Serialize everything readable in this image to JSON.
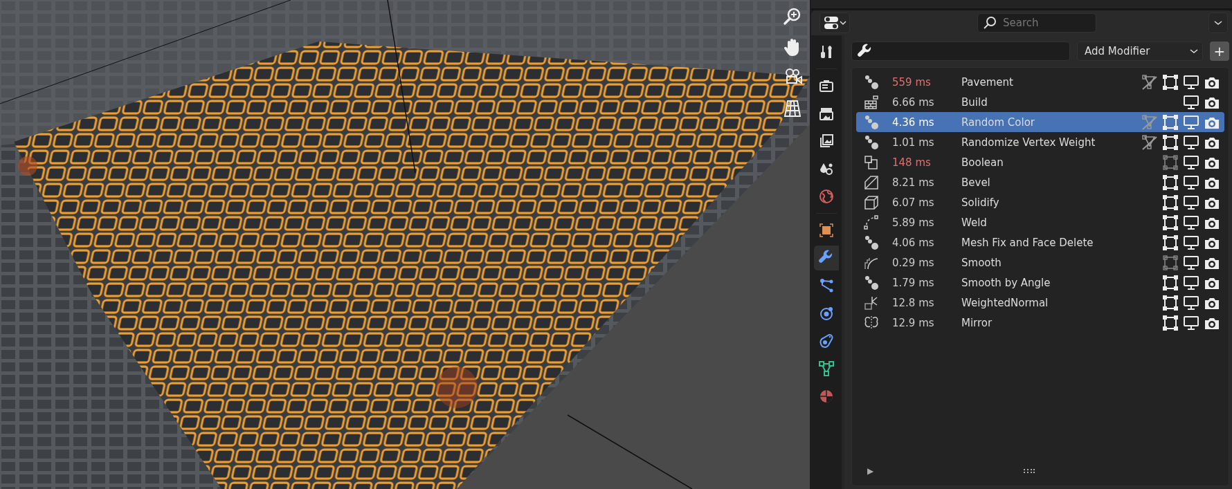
{
  "header": {
    "search": {
      "placeholder": "Search"
    }
  },
  "tabs": [
    {
      "kind": "tool",
      "selected": false
    },
    {
      "kind": "render",
      "selected": false
    },
    {
      "kind": "output",
      "selected": false
    },
    {
      "kind": "view_layer",
      "selected": false
    },
    {
      "kind": "scene",
      "selected": false
    },
    {
      "kind": "world",
      "selected": false
    },
    {
      "kind": "object",
      "selected": false
    },
    {
      "kind": "modifiers",
      "selected": true
    },
    {
      "kind": "particles",
      "selected": false
    },
    {
      "kind": "physics",
      "selected": false
    },
    {
      "kind": "constraints",
      "selected": false
    },
    {
      "kind": "data",
      "selected": false
    },
    {
      "kind": "material",
      "selected": false
    }
  ],
  "toolbar": {
    "add_modifier": "Add Modifier",
    "add_button": "+"
  },
  "modifiers": [
    {
      "kind": "nodes",
      "time": "559 ms",
      "slow": true,
      "name": "Pavement",
      "selected": false,
      "cage_toggle": true,
      "edit_toggle": true,
      "edit_mode": true,
      "viewport": true,
      "render": true
    },
    {
      "kind": "build",
      "time": "6.66 ms",
      "slow": false,
      "name": "Build",
      "selected": false,
      "cage_toggle": false,
      "edit_toggle": false,
      "viewport": true,
      "render": true
    },
    {
      "kind": "nodes",
      "time": "4.36 ms",
      "slow": false,
      "name": "Random Color",
      "selected": true,
      "cage_toggle": true,
      "edit_toggle": true,
      "edit_mode": true,
      "viewport": true,
      "render": true
    },
    {
      "kind": "nodes",
      "time": "1.01 ms",
      "slow": false,
      "name": "Randomize Vertex Weight",
      "selected": false,
      "cage_toggle": true,
      "edit_toggle": true,
      "edit_mode": true,
      "viewport": true,
      "render": true
    },
    {
      "kind": "boolean",
      "time": "148 ms",
      "slow": true,
      "name": "Boolean",
      "selected": false,
      "cage_toggle": false,
      "edit_toggle": true,
      "edit_mode": false,
      "viewport": true,
      "render": true
    },
    {
      "kind": "bevel",
      "time": "8.21 ms",
      "slow": false,
      "name": "Bevel",
      "selected": false,
      "cage_toggle": false,
      "edit_toggle": true,
      "edit_mode": true,
      "viewport": true,
      "render": true
    },
    {
      "kind": "solidify",
      "time": "6.07 ms",
      "slow": false,
      "name": "Solidify",
      "selected": false,
      "cage_toggle": false,
      "edit_toggle": true,
      "edit_mode": true,
      "viewport": true,
      "render": true
    },
    {
      "kind": "weld",
      "time": "5.89 ms",
      "slow": false,
      "name": "Weld",
      "selected": false,
      "cage_toggle": false,
      "edit_toggle": true,
      "edit_mode": true,
      "viewport": true,
      "render": true
    },
    {
      "kind": "nodes",
      "time": "4.06 ms",
      "slow": false,
      "name": "Mesh Fix and Face Delete",
      "selected": false,
      "cage_toggle": false,
      "edit_toggle": true,
      "edit_mode": true,
      "viewport": true,
      "render": true
    },
    {
      "kind": "smooth",
      "time": "0.29 ms",
      "slow": false,
      "name": "Smooth",
      "selected": false,
      "cage_toggle": false,
      "edit_toggle": true,
      "edit_mode": false,
      "viewport": true,
      "render": true
    },
    {
      "kind": "nodes",
      "time": "1.79 ms",
      "slow": false,
      "name": "Smooth by Angle",
      "selected": false,
      "cage_toggle": false,
      "edit_toggle": true,
      "edit_mode": true,
      "viewport": true,
      "render": true
    },
    {
      "kind": "weighted_normal",
      "time": "12.8 ms",
      "slow": false,
      "name": "WeightedNormal",
      "selected": false,
      "cage_toggle": false,
      "edit_toggle": true,
      "edit_mode": true,
      "viewport": true,
      "render": true
    },
    {
      "kind": "mirror",
      "time": "12.9 ms",
      "slow": false,
      "name": "Mirror",
      "selected": false,
      "cage_toggle": false,
      "edit_toggle": true,
      "edit_mode": true,
      "viewport": true,
      "render": true
    }
  ],
  "footer": {
    "expand": "▶"
  }
}
